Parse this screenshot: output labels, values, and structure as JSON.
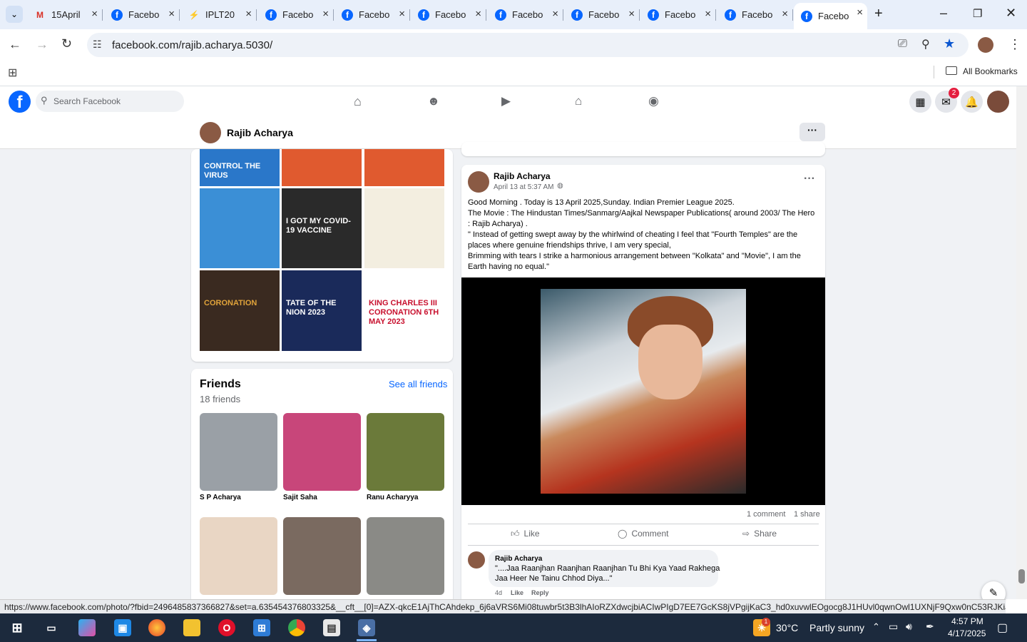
{
  "browser": {
    "tabs": [
      {
        "label": "15April",
        "icon": "gmail-icon"
      },
      {
        "label": "Facebook",
        "icon": "facebook-icon"
      },
      {
        "label": "IPLT20",
        "icon": "ipl-icon"
      },
      {
        "label": "Facebook",
        "icon": "facebook-icon"
      },
      {
        "label": "Facebook",
        "icon": "facebook-icon"
      },
      {
        "label": "Facebook",
        "icon": "facebook-icon"
      },
      {
        "label": "Facebook",
        "icon": "facebook-icon"
      },
      {
        "label": "Facebook",
        "icon": "facebook-icon"
      },
      {
        "label": "Facebook",
        "icon": "facebook-icon"
      },
      {
        "label": "Facebook",
        "icon": "facebook-icon"
      },
      {
        "label": "Facebook",
        "icon": "facebook-icon"
      }
    ],
    "url": "facebook.com/rajib.acharya.5030/",
    "bookmarks_label": "All Bookmarks",
    "status_url": "https://www.facebook.com/photo/?fbid=2496485837366827&set=a.635454376803325&__cft__[0]=AZX-qkcE1AjThCAhdekp_6j6aVRS6Mi08tuwbr5t3B3lhAIoRZXdwcjbiACIwPIgD7EE7GcKS8jVPgijKaC3_hd0xuvwlEOgocg8J1HUvl0qwnOwl1UXNjF9Qxw0nC53RJKiJFT6..."
  },
  "fb": {
    "search_placeholder": "Search Facebook",
    "messenger_badge": "2",
    "profile_name": "Rajib Acharya"
  },
  "photos": {
    "tiles": [
      "CONTROL THE VIRUS",
      "",
      "",
      "",
      "I GOT MY COVID-19 VACCINE",
      "",
      "CORONATION",
      "TATE OF THE NION 2023",
      "KING CHARLES III CORONATION 6TH MAY 2023"
    ]
  },
  "friends": {
    "title": "Friends",
    "see_all": "See all friends",
    "count": "18 friends",
    "list": [
      {
        "name": "S P Acharya",
        "color": "#9aa0a6"
      },
      {
        "name": "Sajit Saha",
        "color": "#c8467a"
      },
      {
        "name": "Ranu Acharyya",
        "color": "#6b7a3a"
      },
      {
        "name": "",
        "color": "#e9d6c4"
      },
      {
        "name": "",
        "color": "#7a6a60"
      },
      {
        "name": "",
        "color": "#8a8a86"
      }
    ]
  },
  "post": {
    "author": "Rajib Acharya",
    "time": "April 13 at 5:37 AM",
    "text_lines": [
      "Good Morning . Today is 13 April 2025,Sunday. Indian Premier League 2025.",
      "The Movie : The Hindustan Times/Sanmarg/Aajkal Newspaper Publications( around 2003/ The Hero",
      ": Rajib Acharya) .",
      "\" Instead of getting swept away by the whirlwind of cheating I feel that \"Fourth Temples\" are the",
      "places where genuine friendships thrive, I am very special,",
      "Brimming with tears I strike a harmonious arrangement between \"Kolkata\" and \"Movie\", I am the",
      "Earth having no equal.\""
    ],
    "comments_count": "1 comment",
    "shares_count": "1 share",
    "like_label": "Like",
    "comment_label": "Comment",
    "share_label": "Share",
    "comment": {
      "author": "Rajib Acharya",
      "line1": "\"....Jaa Raanjhan Raanjhan Raanjhan Tu Bhi Kya Yaad Rakhega",
      "line2": "Jaa Heer Ne Tainu Chhod Diya...\"",
      "age": "4d",
      "like": "Like",
      "reply": "Reply"
    }
  },
  "taskbar": {
    "temp": "30°C",
    "weather": "Partly sunny",
    "time": "4:57 PM",
    "date": "4/17/2025",
    "weather_badge": "1"
  }
}
